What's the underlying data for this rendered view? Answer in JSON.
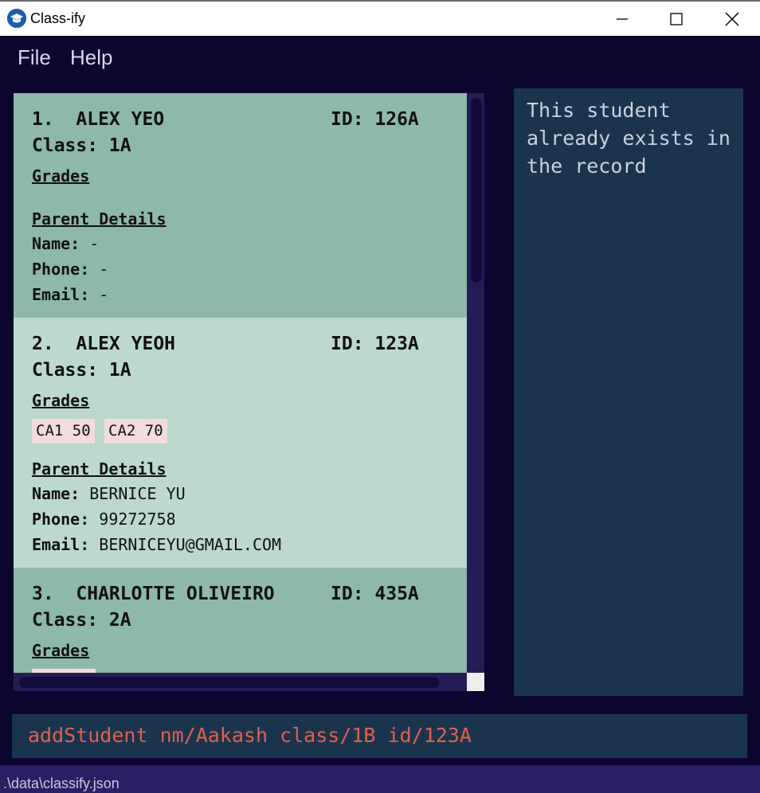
{
  "window": {
    "title": "Class-ify",
    "minimize_icon": "minimize-icon",
    "maximize_icon": "maximize-icon",
    "close_icon": "close-icon"
  },
  "menu": {
    "file": "File",
    "help": "Help"
  },
  "students": [
    {
      "header": "1.  ALEX YEO",
      "id": "ID: 126A",
      "class": "Class: 1A",
      "grades_title": "Grades",
      "grades": [],
      "parent_title": "Parent Details",
      "name_label": "Name:",
      "name": " -",
      "phone_label": "Phone:",
      "phone": " -",
      "email_label": "Email:",
      "email": " -"
    },
    {
      "header": "2.  ALEX YEOH",
      "id": "ID: 123A",
      "class": "Class: 1A",
      "grades_title": "Grades",
      "grades": [
        "CA1 50",
        "CA2 70"
      ],
      "parent_title": "Parent Details",
      "name_label": "Name:",
      "name": " BERNICE YU",
      "phone_label": "Phone:",
      "phone": " 99272758",
      "email_label": "Email:",
      "email": " BERNICEYU@GMAIL.COM"
    },
    {
      "header": "3.  CHARLOTTE OLIVEIRO",
      "id": "ID: 435A",
      "class": "Class: 2A",
      "grades_title": "Grades"
    }
  ],
  "result": {
    "message": "This student already exists in the record"
  },
  "command": {
    "value": "addStudent nm/Aakash class/1B id/123A"
  },
  "status": {
    "path": ".\\data\\classify.json"
  },
  "colors": {
    "background": "#0c0630",
    "card_dark": "#8db9aa",
    "card_light": "#bcd9ce",
    "grade_tag": "#f2dcdc",
    "panel": "#1a344e",
    "command_text": "#e0604c"
  }
}
